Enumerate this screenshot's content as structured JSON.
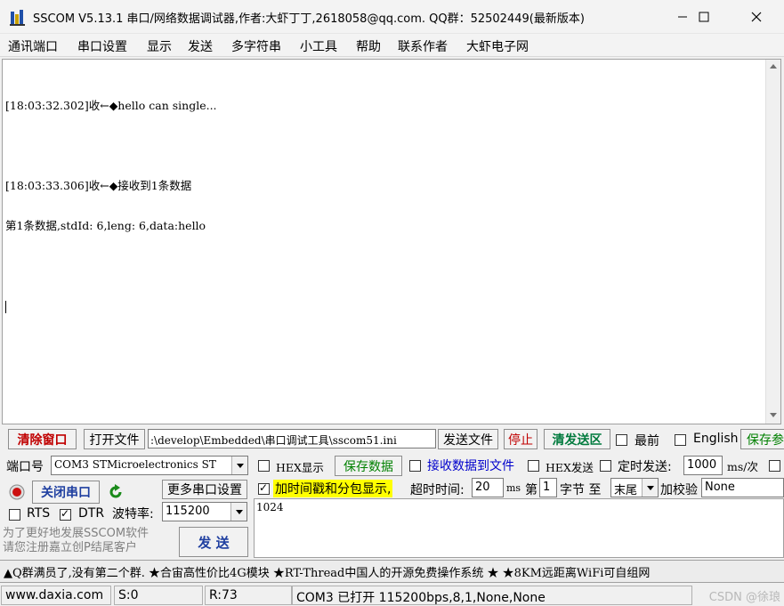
{
  "window": {
    "title": "SSCOM V5.13.1 串口/网络数据调试器,作者:大虾丁丁,2618058@qq.com. QQ群：52502449(最新版本)"
  },
  "menu": [
    "通讯端口",
    "串口设置",
    "显示",
    "发送",
    "多字符串",
    "小工具",
    "帮助",
    "联系作者",
    "大虾电子网"
  ],
  "receive": {
    "lines": [
      "[18:03:32.302]收←◆hello can single...",
      "",
      "[18:03:33.306]收←◆接收到1条数据",
      "第1条数据,stdId: 6,leng: 6,data:hello",
      ""
    ]
  },
  "toolbar": {
    "clear_window": "清除窗口",
    "open_file": "打开文件",
    "file_path": ":\\develop\\Embedded\\串口调试工具\\sscom51.ini",
    "send_file": "发送文件",
    "stop": "停止",
    "clear_send": "清发送区",
    "top_label": "最前",
    "english_label": "English",
    "save_params": "保存参"
  },
  "port": {
    "port_label": "端口号",
    "port_value": "COM3 STMicroelectronics ST",
    "close_port": "关闭串口",
    "more_settings": "更多串口设置",
    "rts_label": "RTS",
    "dtr_label": "DTR",
    "baud_label": "波特率:",
    "baud_value": "115200",
    "rts_checked": false,
    "dtr_checked": true
  },
  "options": {
    "hex_display": "HEX显示",
    "save_data": "保存数据",
    "recv_to_file": "接收数据到文件",
    "hex_send": "HEX发送",
    "timed_send": "定时发送:",
    "interval_value": "1000",
    "interval_unit": "ms/次",
    "timestamp_label": "加时间戳和分包显示,",
    "timeout_label": "超时时间:",
    "timeout_value": "20",
    "timeout_unit": "ms",
    "byte_prefix": "第",
    "byte_value": "1",
    "byte_label": "字节 至",
    "byte_end_value": "末尾",
    "checksum_label": "加校验",
    "checksum_value": "None",
    "timestamp_checked": true
  },
  "promo": {
    "line1": "为了更好地发展SSCOM软件",
    "line2": "请您注册嘉立创P结尾客户"
  },
  "send": {
    "button": "发 送",
    "content": "1024"
  },
  "adbar": {
    "text": "▲Q群满员了,没有第二个群. ★合宙高性价比4G模块 ★RT-Thread中国人的开源免费操作系统 ★ ★8KM远距离WiFi可自组网"
  },
  "status": {
    "website": "www.daxia.com",
    "sent": "S:0",
    "received": "R:73",
    "port_info": "COM3 已打开  115200bps,8,1,None,None",
    "watermark": "CSDN @徐琅"
  },
  "colors": {
    "accent_red": "#c00000",
    "accent_green": "#008000",
    "highlight_yellow": "#ffff00",
    "link_blue": "#0000cc"
  }
}
